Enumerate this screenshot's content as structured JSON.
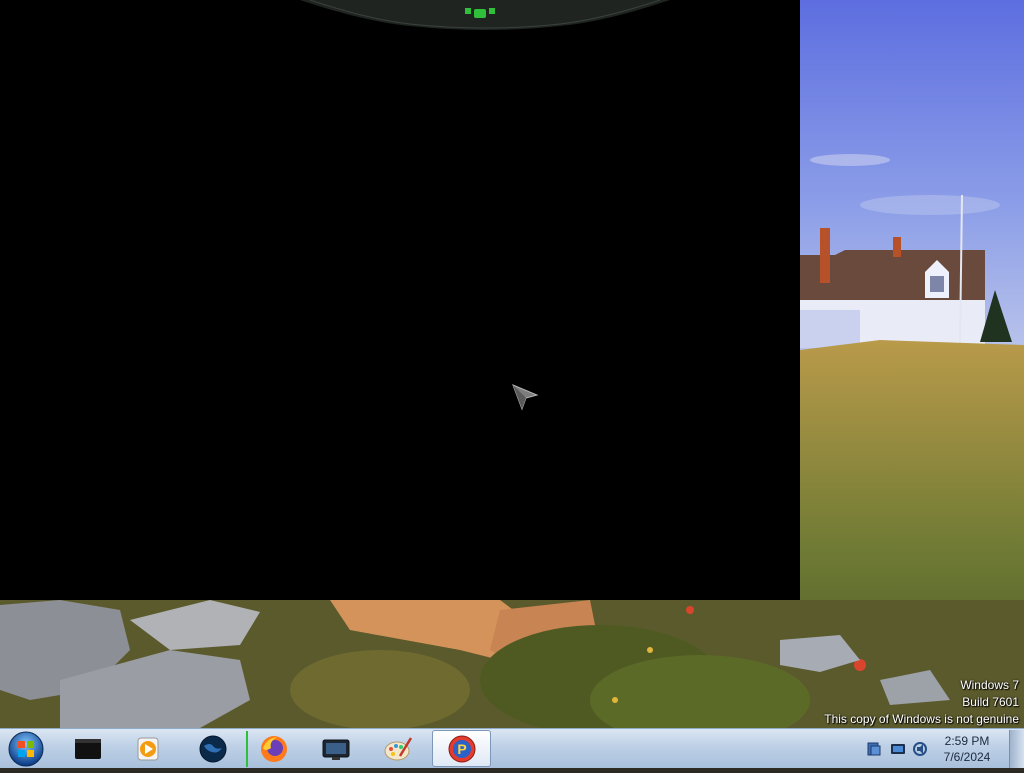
{
  "watermark": {
    "os_name": "Windows 7",
    "build": "Build 7601",
    "notice": "This copy of Windows is not genuine"
  },
  "taskbar": {
    "start_icon": "windows-orb-icon",
    "items": [
      {
        "icon": "terminal-icon",
        "active": false
      },
      {
        "icon": "media-player-icon",
        "active": false
      },
      {
        "icon": "globe-icon",
        "active": false
      },
      {
        "icon": "firefox-icon",
        "active": false
      },
      {
        "icon": "remote-desktop-icon",
        "active": false
      },
      {
        "icon": "paint-icon",
        "active": false
      },
      {
        "icon": "app-p-icon",
        "active": true
      }
    ]
  },
  "tray": {
    "icons": [
      "action-center-icon",
      "network-icon",
      "volume-icon"
    ],
    "time": "2:59 PM",
    "date": "7/6/2024"
  },
  "colors": {
    "accent_green": "#2fbf3a",
    "taskbar_bg": "#bdd0e6",
    "window_bg": "#000000"
  }
}
